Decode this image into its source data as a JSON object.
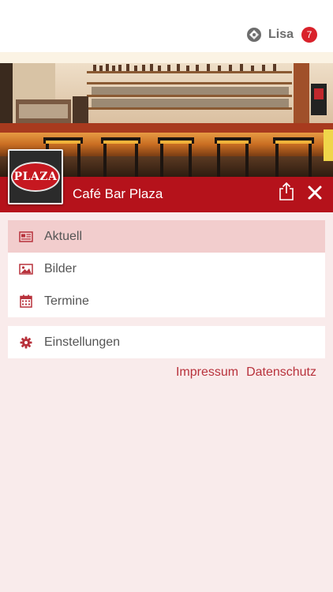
{
  "header": {
    "user_name": "Lisa",
    "notification_count": "7",
    "user_icon": "user-network-icon"
  },
  "hero": {
    "image": "bar-interior-photo"
  },
  "venue": {
    "logo_text": "PLAZA",
    "title": "Café Bar Plaza",
    "share_icon": "share-icon",
    "close_icon": "close-icon",
    "accent_color": "#b5121b"
  },
  "menu": {
    "items": [
      {
        "label": "Aktuell",
        "icon": "news-icon",
        "active": true
      },
      {
        "label": "Bilder",
        "icon": "image-icon",
        "active": false
      },
      {
        "label": "Termine",
        "icon": "calendar-icon",
        "active": false
      }
    ],
    "settings": {
      "label": "Einstellungen",
      "icon": "gear-icon"
    }
  },
  "footer_links": {
    "impressum": "Impressum",
    "datenschutz": "Datenschutz"
  }
}
